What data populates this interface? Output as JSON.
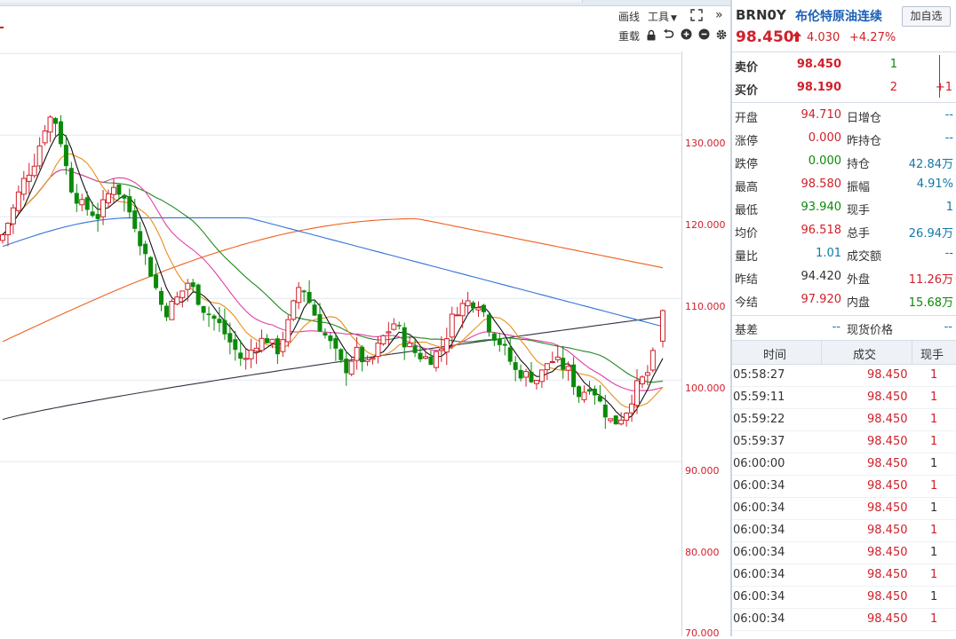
{
  "toolbar": {
    "draw_label": "画线",
    "tools_label": "工具",
    "reload_label": "重载"
  },
  "colors": {
    "up": "#d0202a",
    "down": "#0a8a0a",
    "ma5": "#111111",
    "ma10": "#e8901a",
    "ma20": "#e040a8",
    "ma30": "#228822",
    "ma60": "#3070d8",
    "ma120": "#f06020",
    "ma250": "#333344"
  },
  "chart_data": {
    "type": "candlestick",
    "y_ticks": [
      "130.000",
      "120.000",
      "110.000",
      "100.000",
      "90.000",
      "80.000",
      "70.000"
    ],
    "ylim": [
      70,
      134
    ],
    "last": {
      "open": 94.71,
      "high": 98.58,
      "low": 93.94,
      "close": 98.45
    }
  },
  "quote": {
    "code": "BRN0Y",
    "name": "布伦特原油连续",
    "add_button": "加自选",
    "price": "98.450",
    "change": "4.030",
    "change_pct": "+4.27%",
    "ask_label": "卖价",
    "ask_price": "98.450",
    "ask_vol": "1",
    "bid_label": "买价",
    "bid_price": "98.190",
    "bid_vol": "2",
    "bid_change": "+1",
    "stats": [
      {
        "l1": "开盘",
        "v1": "94.710",
        "c1": "red",
        "l2": "日增仓",
        "v2": "--",
        "c2": "teal"
      },
      {
        "l1": "涨停",
        "v1": "0.000",
        "c1": "red",
        "l2": "昨持仓",
        "v2": "--",
        "c2": "teal"
      },
      {
        "l1": "跌停",
        "v1": "0.000",
        "c1": "green",
        "l2": "持仓",
        "v2": "42.84万",
        "c2": "teal"
      },
      {
        "l1": "最高",
        "v1": "98.580",
        "c1": "red",
        "l2": "振幅",
        "v2": "4.91%",
        "c2": "teal"
      },
      {
        "l1": "最低",
        "v1": "93.940",
        "c1": "green",
        "l2": "现手",
        "v2": "1",
        "c2": "teal"
      },
      {
        "l1": "均价",
        "v1": "96.518",
        "c1": "red",
        "l2": "总手",
        "v2": "26.94万",
        "c2": "teal"
      },
      {
        "l1": "量比",
        "v1": "1.01",
        "c1": "teal",
        "l2": "成交额",
        "v2": "--",
        "c2": "teal"
      },
      {
        "l1": "昨结",
        "v1": "94.420",
        "c1": "",
        "l2": "外盘",
        "v2": "11.26万",
        "c2": "red"
      },
      {
        "l1": "今结",
        "v1": "97.920",
        "c1": "red",
        "l2": "内盘",
        "v2": "15.68万",
        "c2": "green"
      }
    ],
    "basis_label": "基差",
    "basis_value": "--",
    "spot_label": "现货价格",
    "spot_value": "--"
  },
  "ticks": {
    "headers": [
      "时间",
      "成交",
      "现手"
    ],
    "rows": [
      {
        "time": "05:58:27",
        "price": "98.450",
        "vol": "1",
        "vc": "red"
      },
      {
        "time": "05:59:11",
        "price": "98.450",
        "vol": "1",
        "vc": "red"
      },
      {
        "time": "05:59:22",
        "price": "98.450",
        "vol": "1",
        "vc": "red"
      },
      {
        "time": "05:59:37",
        "price": "98.450",
        "vol": "1",
        "vc": "red"
      },
      {
        "time": "06:00:00",
        "price": "98.450",
        "vol": "1",
        "vc": "dark"
      },
      {
        "time": "06:00:34",
        "price": "98.450",
        "vol": "1",
        "vc": "red"
      },
      {
        "time": "06:00:34",
        "price": "98.450",
        "vol": "1",
        "vc": "dark"
      },
      {
        "time": "06:00:34",
        "price": "98.450",
        "vol": "1",
        "vc": "red"
      },
      {
        "time": "06:00:34",
        "price": "98.450",
        "vol": "1",
        "vc": "dark"
      },
      {
        "time": "06:00:34",
        "price": "98.450",
        "vol": "1",
        "vc": "red"
      },
      {
        "time": "06:00:34",
        "price": "98.450",
        "vol": "1",
        "vc": "dark"
      },
      {
        "time": "06:00:34",
        "price": "98.450",
        "vol": "1",
        "vc": "red"
      }
    ]
  }
}
